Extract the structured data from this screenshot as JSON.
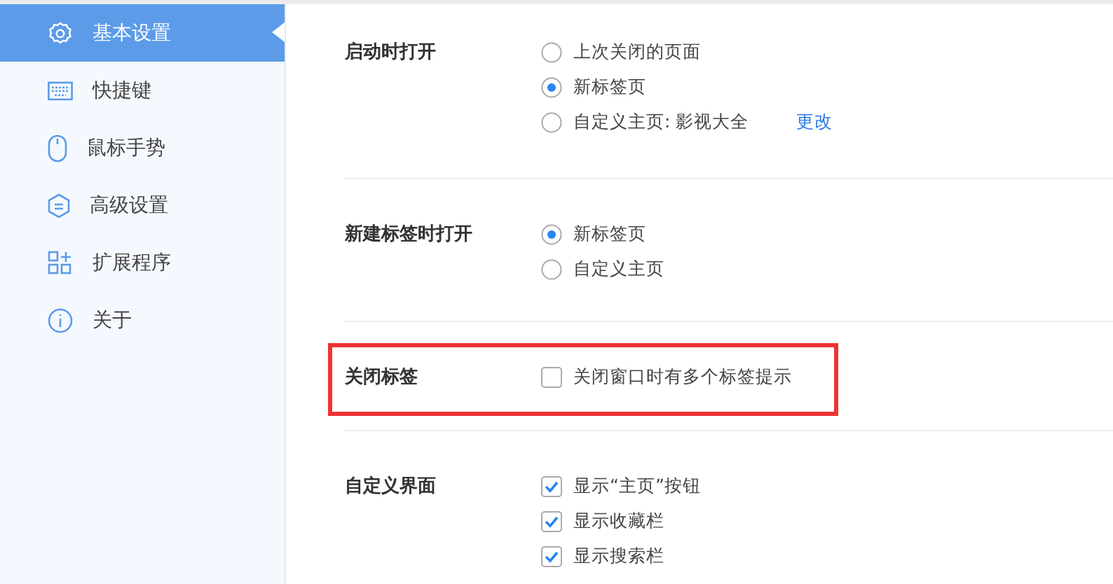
{
  "sidebar": {
    "items": [
      {
        "label": "基本设置",
        "selected": true
      },
      {
        "label": "快捷键",
        "selected": false
      },
      {
        "label": "鼠标手势",
        "selected": false
      },
      {
        "label": "高级设置",
        "selected": false
      },
      {
        "label": "扩展程序",
        "selected": false
      },
      {
        "label": "关于",
        "selected": false
      }
    ]
  },
  "sections": [
    {
      "label": "启动时打开",
      "highlighted": false,
      "options": [
        {
          "kind": "radio",
          "label": "上次关闭的页面",
          "selected": false
        },
        {
          "kind": "radio",
          "label": "新标签页",
          "selected": true
        },
        {
          "kind": "radio",
          "label": "自定义主页: 影视大全",
          "selected": false,
          "link": "更改"
        }
      ]
    },
    {
      "label": "新建标签时打开",
      "highlighted": false,
      "options": [
        {
          "kind": "radio",
          "label": "新标签页",
          "selected": true
        },
        {
          "kind": "radio",
          "label": "自定义主页",
          "selected": false
        }
      ]
    },
    {
      "label": "关闭标签",
      "highlighted": true,
      "options": [
        {
          "kind": "checkbox",
          "label": "关闭窗口时有多个标签提示",
          "checked": false
        }
      ]
    },
    {
      "label": "自定义界面",
      "highlighted": false,
      "options": [
        {
          "kind": "checkbox",
          "label": "显示“主页”按钮",
          "checked": true
        },
        {
          "kind": "checkbox",
          "label": "显示收藏栏",
          "checked": true
        },
        {
          "kind": "checkbox",
          "label": "显示搜索栏",
          "checked": true
        }
      ]
    }
  ]
}
